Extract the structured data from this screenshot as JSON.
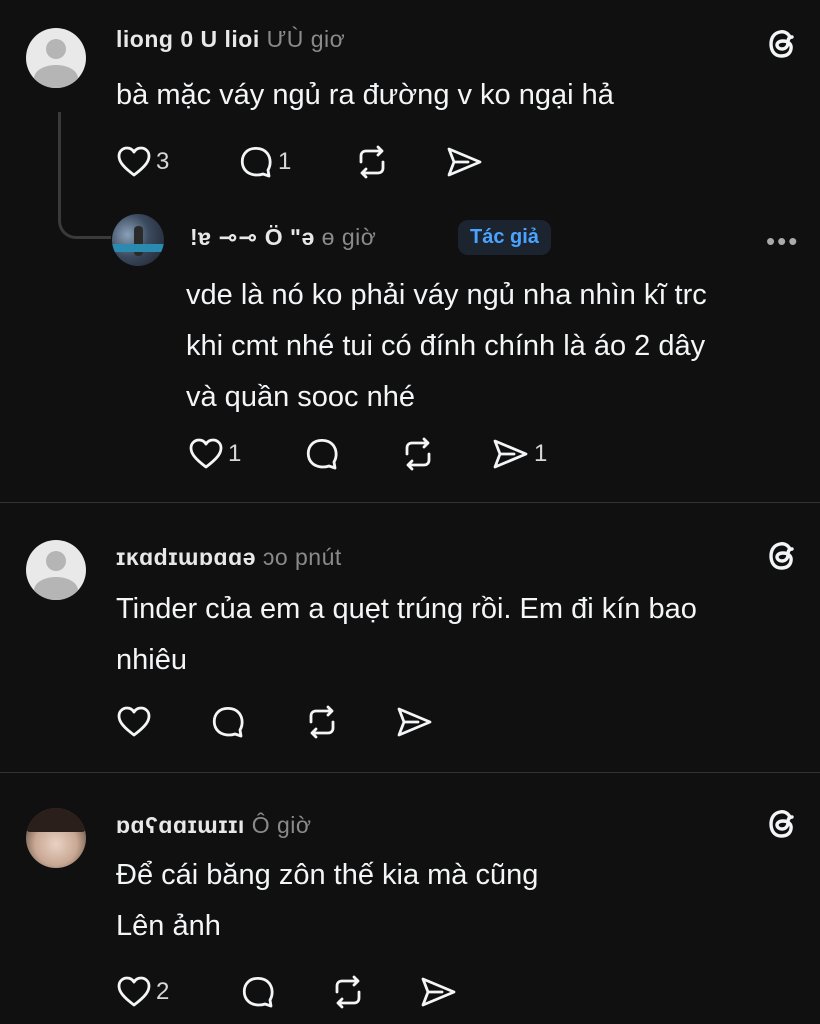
{
  "comments": [
    {
      "author": "liong 0 U lioi",
      "time": "ƯÙ giơ",
      "text": [
        "bà mặc váy ngủ ra đường v ko ngại hả"
      ],
      "likes": "3",
      "replies": "1",
      "reposts": "",
      "shares": "",
      "avatar": "default"
    },
    {
      "author": "!ɐ ⊸⊸ Ö ʺə",
      "time": "ɵ giờ",
      "badge": "Tác giả",
      "text": [
        "vde là nó ko phải váy ngủ nha nhìn kĩ trc",
        "khi cmt nhé tui có đính chính là áo 2 dây",
        "và quần sooc nhé"
      ],
      "likes": "1",
      "replies": "",
      "reposts": "",
      "shares": "1",
      "avatar": "photo"
    },
    {
      "author": "ɪĸɑdɪɯɒɑɑə",
      "time": "ɔo pnút",
      "text": [
        "Tinder của em a quẹt trúng rồi. Em đi kín bao",
        "nhiêu"
      ],
      "likes": "",
      "replies": "",
      "reposts": "",
      "shares": "",
      "avatar": "default"
    },
    {
      "author": "ɒɑʕɑɑɪɯɪɪı",
      "time": "Ô giờ",
      "text": [
        "Để cái băng zôn thế kia mà cũng",
        "Lên ảnh"
      ],
      "likes": "2",
      "replies": "",
      "reposts": "",
      "shares": "",
      "avatar": "photo"
    }
  ],
  "icons": {
    "like": "heart-icon",
    "reply": "comment-icon",
    "repost": "repost-icon",
    "share": "send-icon",
    "threads": "threads-logo-icon",
    "more": "more-icon"
  },
  "colors": {
    "background": "#101010",
    "text": "#f3f5f7",
    "badge_text": "#4aa3ff",
    "badge_bg": "#1c2430"
  },
  "more_label": "•••"
}
